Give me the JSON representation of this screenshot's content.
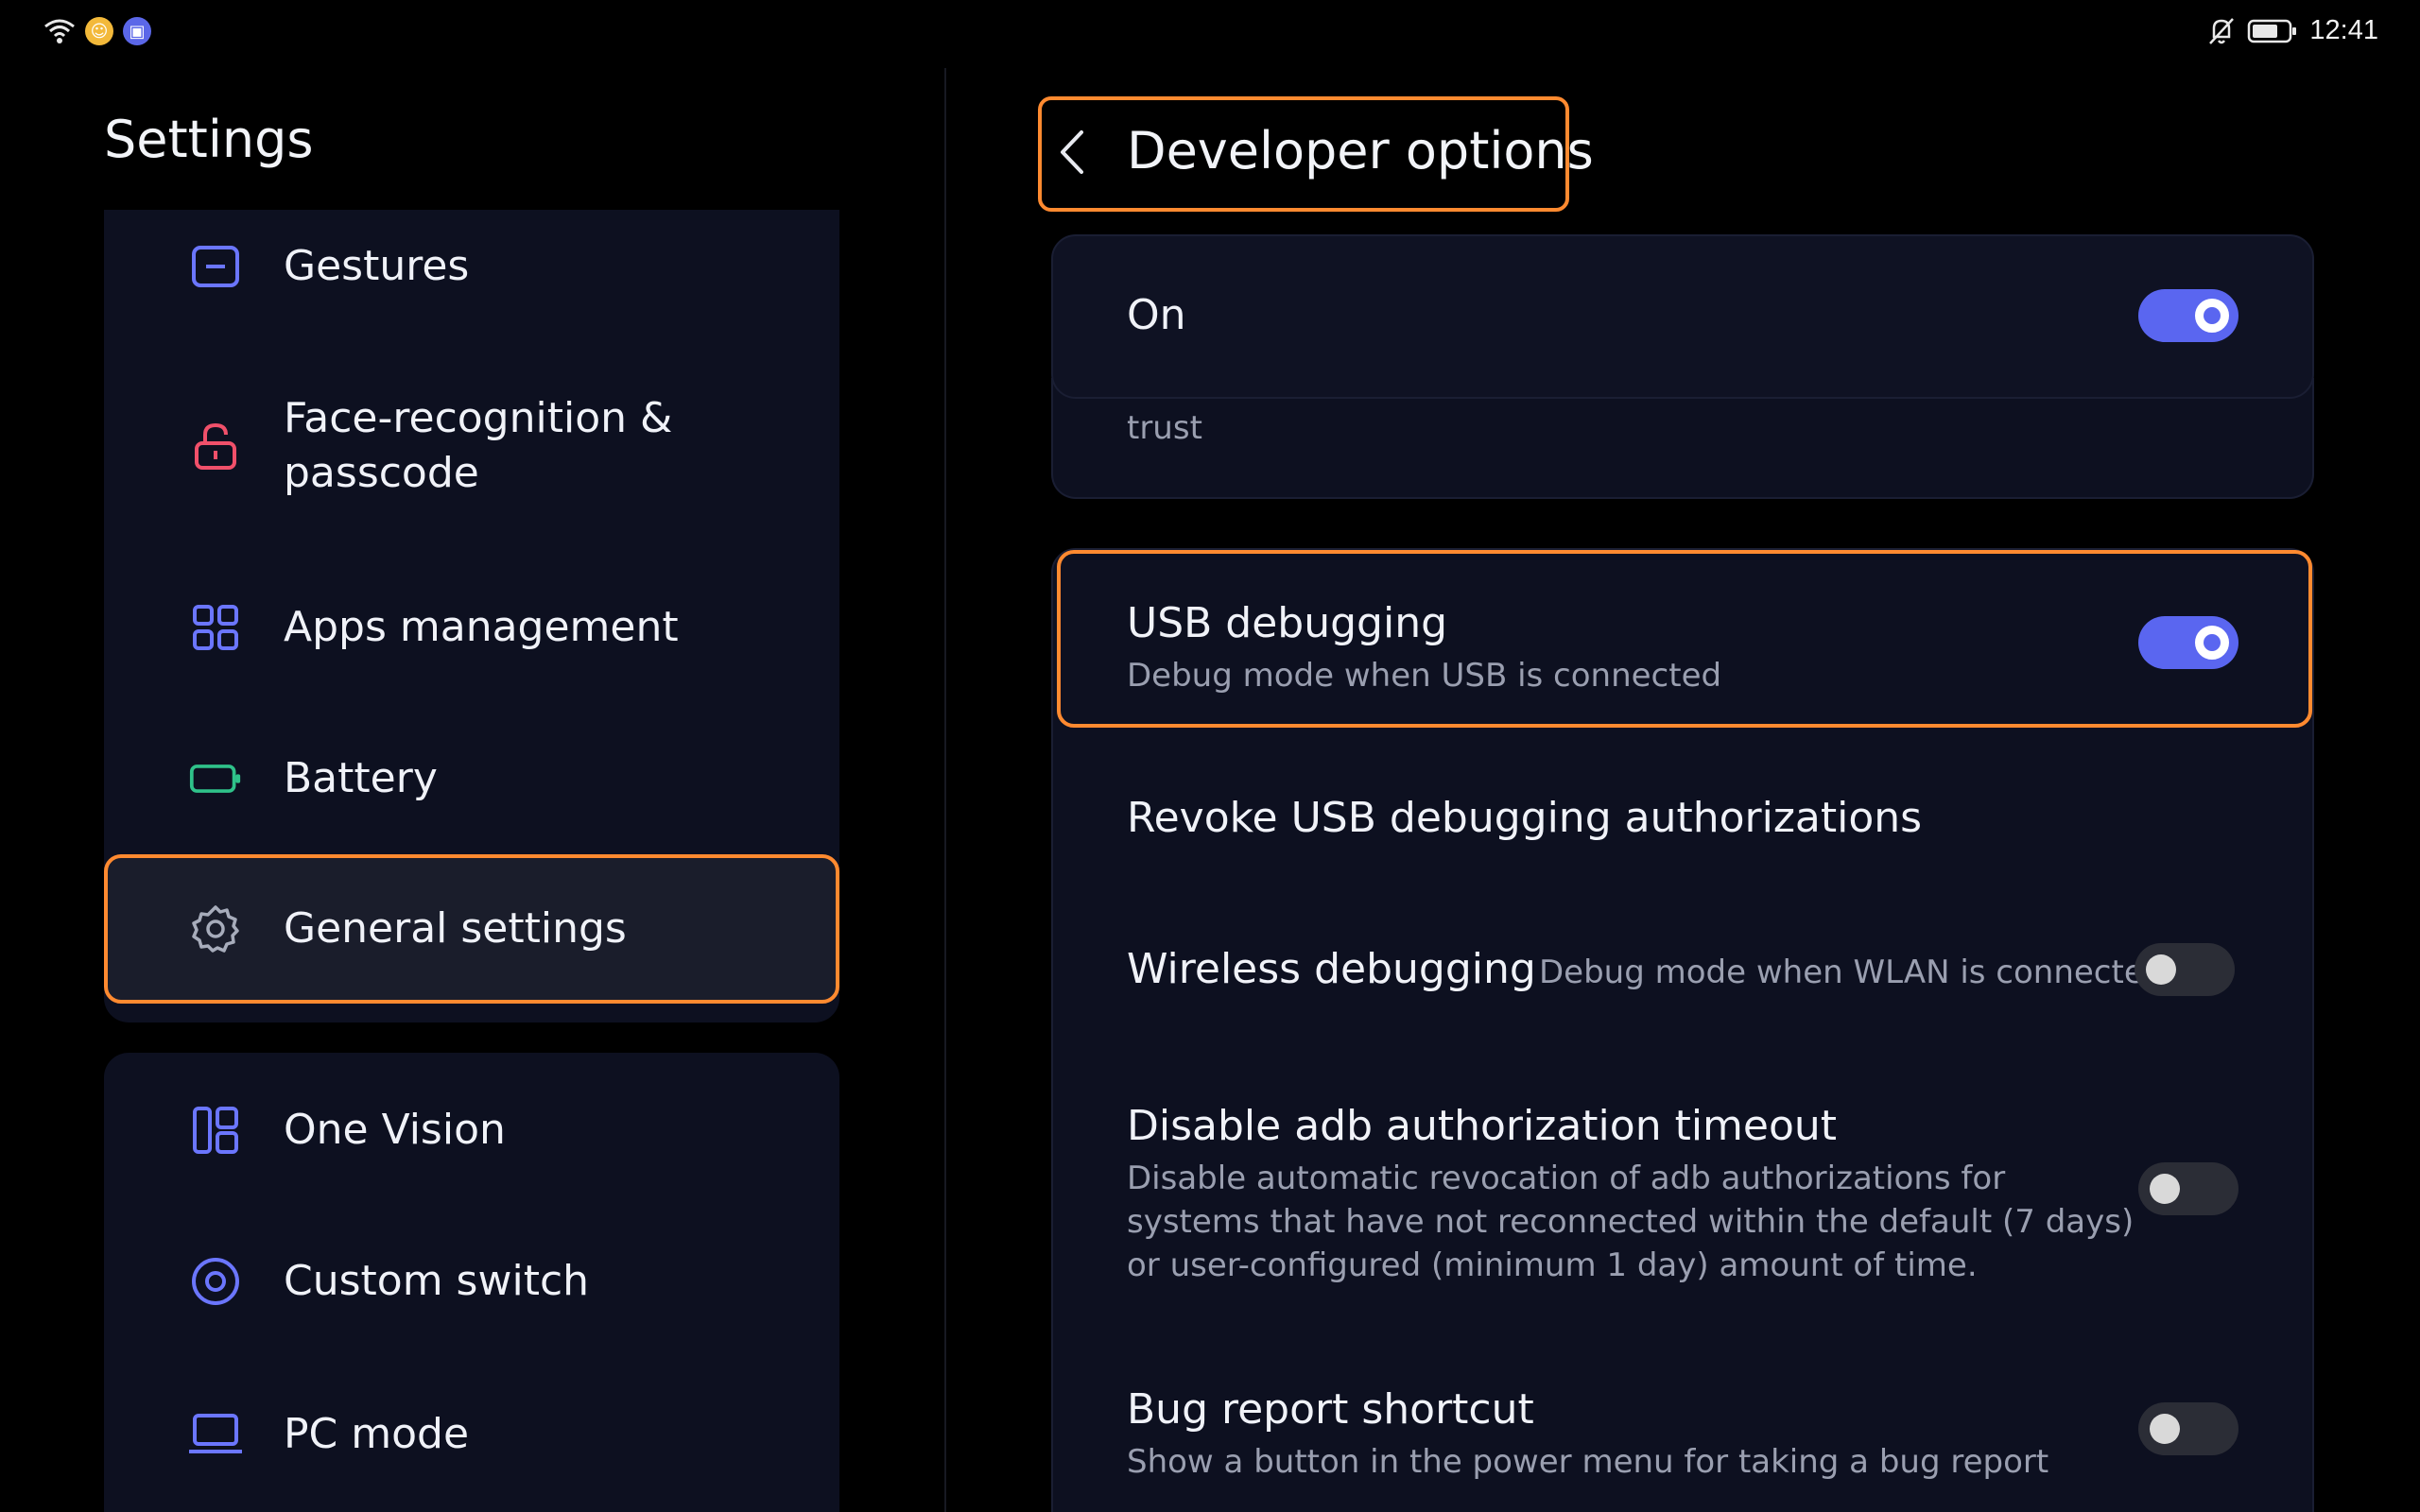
{
  "status_bar": {
    "time": "12:41",
    "icons": [
      "wifi-icon",
      "notification-dot-yellow",
      "notification-dot-blue",
      "bell-muted-icon",
      "battery-icon"
    ]
  },
  "left": {
    "title": "Settings",
    "items": [
      {
        "label": "Gestures",
        "icon": "gestures-icon"
      },
      {
        "label": "Face-recognition & passcode",
        "icon": "lock-icon"
      },
      {
        "label": "Apps management",
        "icon": "apps-grid-icon"
      },
      {
        "label": "Battery",
        "icon": "battery-icon"
      },
      {
        "label": "General settings",
        "icon": "gear-icon"
      },
      {
        "label": "One Vision",
        "icon": "one-vision-icon"
      },
      {
        "label": "Custom switch",
        "icon": "custom-switch-icon"
      },
      {
        "label": "PC mode",
        "icon": "laptop-icon"
      }
    ]
  },
  "right": {
    "title": "Developer options",
    "on": {
      "label": "On",
      "enabled": true
    },
    "trust_text": "trust",
    "usb_debugging": {
      "label": "USB debugging",
      "desc": "Debug mode when USB is connected",
      "enabled": true
    },
    "revoke": {
      "label": "Revoke USB debugging authorizations"
    },
    "wireless": {
      "label": "Wireless debugging",
      "desc": "Debug mode when WLAN is connected",
      "enabled": false
    },
    "adb_timeout": {
      "label": "Disable adb authorization timeout",
      "desc_lines": [
        "Disable automatic revocation of adb authorizations for",
        "systems that have not reconnected within the default (7 days)",
        "or user-configured (minimum 1 day) amount of time."
      ],
      "enabled": false
    },
    "bug_report": {
      "label": "Bug report shortcut",
      "desc": "Show a button in the power menu for taking a bug report",
      "enabled": false
    }
  },
  "colors": {
    "accent": "#5a66f0",
    "highlight": "#ff8a30",
    "background": "#000000",
    "card": "#0d1020"
  }
}
